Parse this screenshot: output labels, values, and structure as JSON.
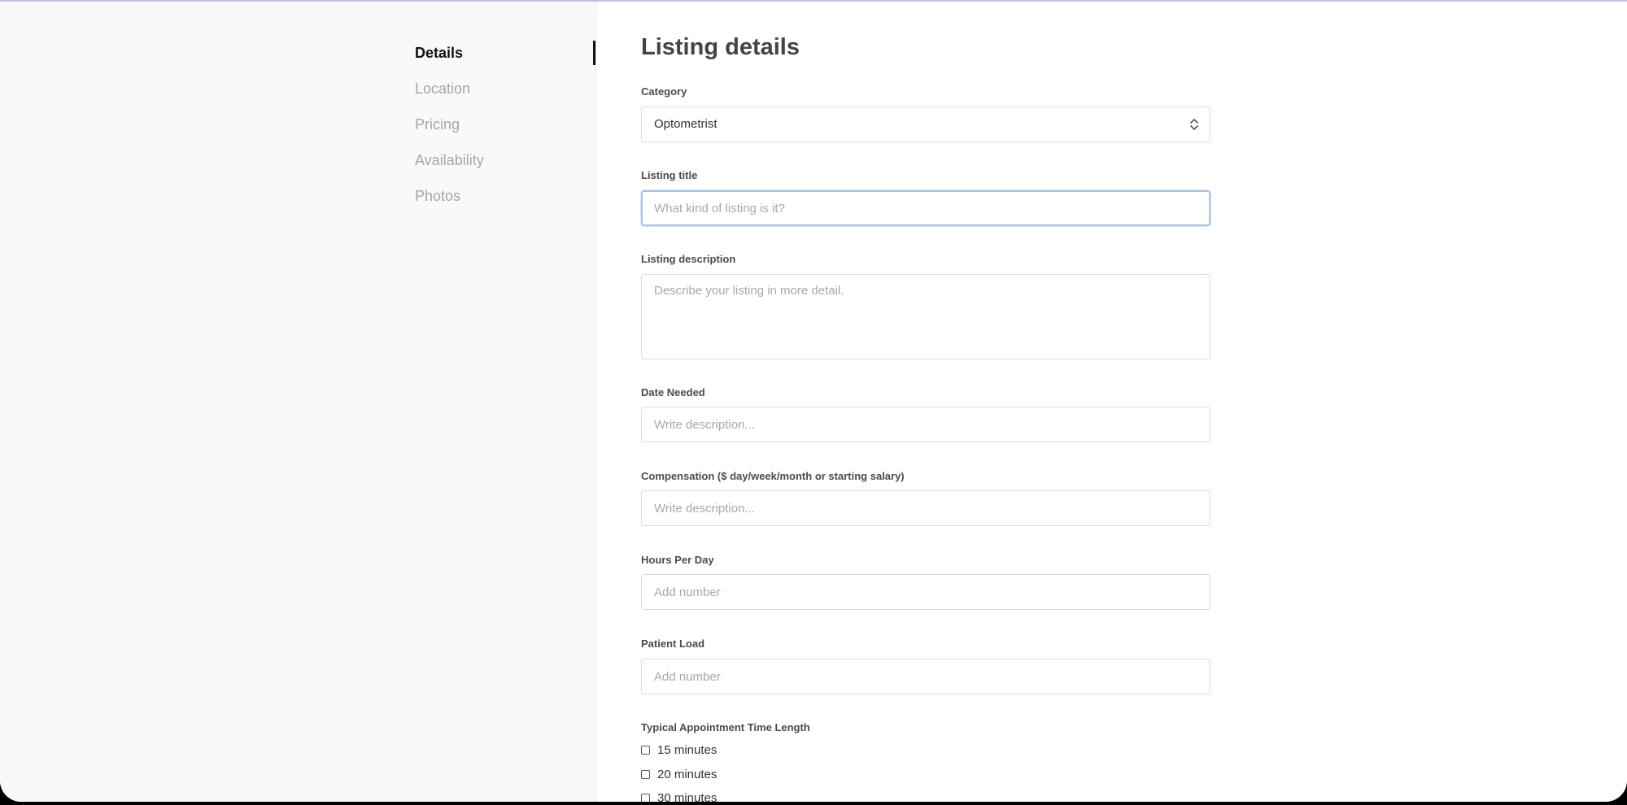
{
  "sidebar": {
    "items": [
      {
        "label": "Details",
        "active": true
      },
      {
        "label": "Location",
        "active": false
      },
      {
        "label": "Pricing",
        "active": false
      },
      {
        "label": "Availability",
        "active": false
      },
      {
        "label": "Photos",
        "active": false
      }
    ]
  },
  "main": {
    "title": "Listing details",
    "category": {
      "label": "Category",
      "value": "Optometrist"
    },
    "listing_title": {
      "label": "Listing title",
      "value": "",
      "placeholder": "What kind of listing is it?"
    },
    "listing_description": {
      "label": "Listing description",
      "value": "",
      "placeholder": "Describe your listing in more detail."
    },
    "date_needed": {
      "label": "Date Needed",
      "value": "",
      "placeholder": "Write description..."
    },
    "compensation": {
      "label": "Compensation ($ day/week/month or starting salary)",
      "value": "",
      "placeholder": "Write description..."
    },
    "hours_per_day": {
      "label": "Hours Per Day",
      "value": "",
      "placeholder": "Add number"
    },
    "patient_load": {
      "label": "Patient Load",
      "value": "",
      "placeholder": "Add number"
    },
    "appointment_length": {
      "label": "Typical Appointment Time Length",
      "options": [
        {
          "label": "15 minutes",
          "checked": false
        },
        {
          "label": "20 minutes",
          "checked": false
        },
        {
          "label": "30 minutes",
          "checked": false
        }
      ]
    }
  },
  "colors": {
    "focus_ring": "#a7c4ea",
    "sidebar_bg": "#f9f9f9",
    "active_nav": "#111111",
    "inactive_nav": "#a6a6a6"
  }
}
